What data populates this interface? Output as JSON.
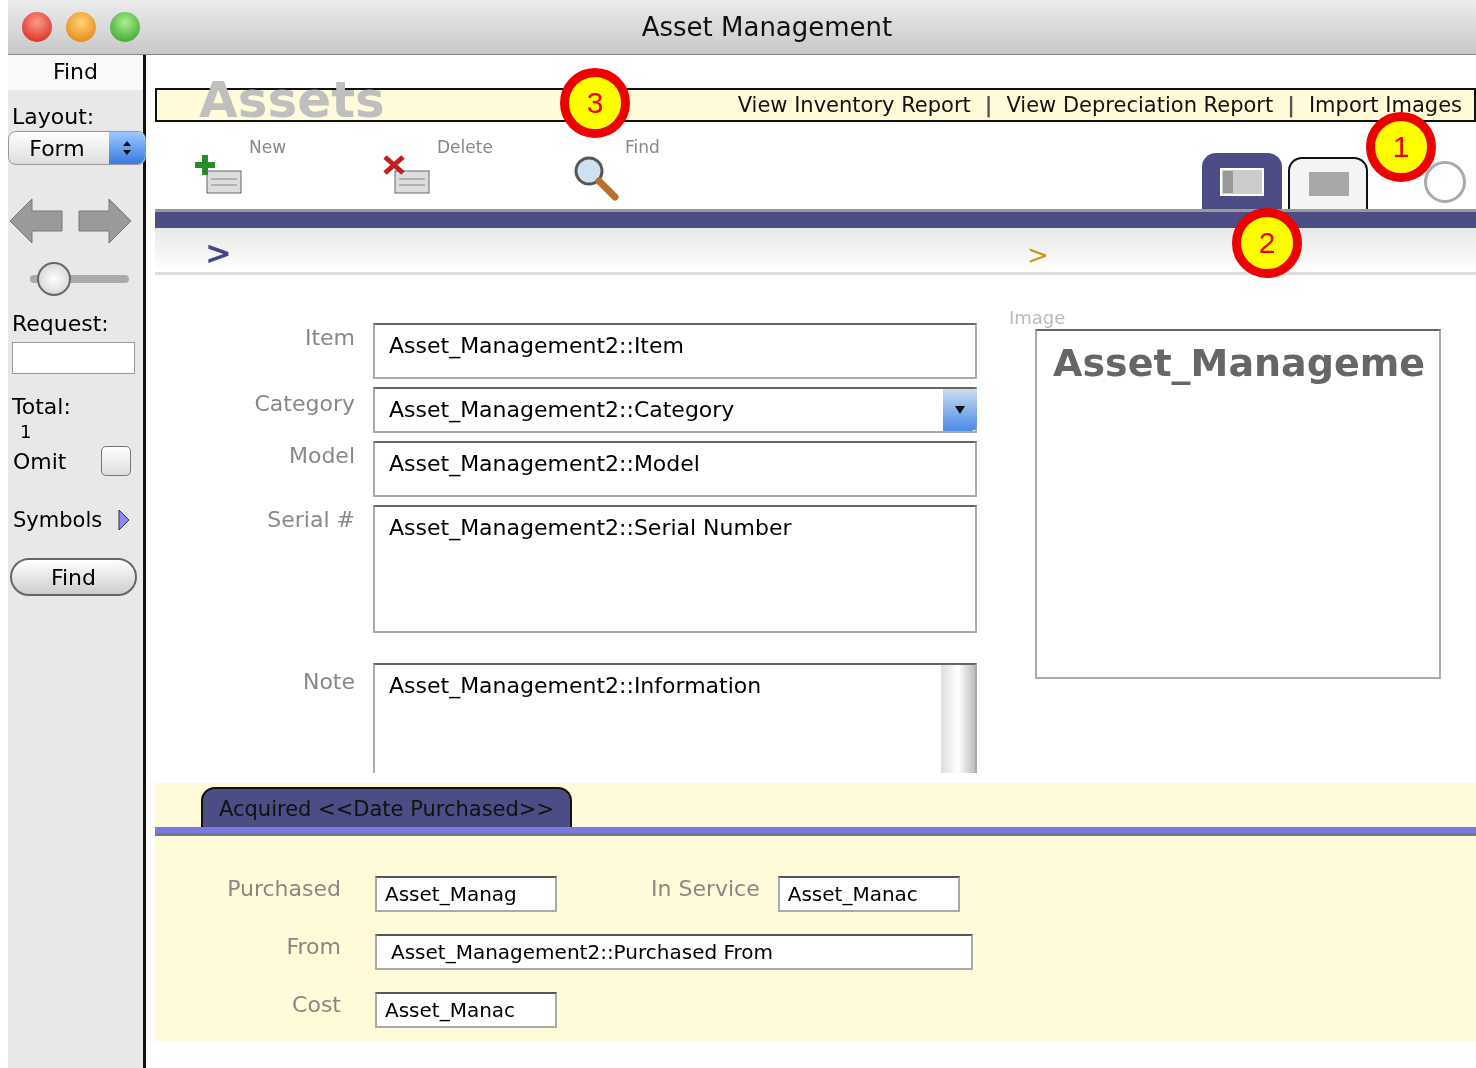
{
  "window": {
    "title": "Asset Management"
  },
  "sidebar": {
    "mode_title": "Find",
    "layout_label": "Layout:",
    "layout_value": "Form",
    "slider": {
      "level": 0.1
    },
    "request_label": "Request:",
    "total_label": "Total:",
    "total_value": "1",
    "omit": {
      "label": "Omit",
      "checked": false
    },
    "symbols_label": "Symbols",
    "find_button": "Find"
  },
  "header": {
    "title": "Assets",
    "links": [
      {
        "label": "View Inventory Report"
      },
      {
        "label": "View Depreciation Report"
      },
      {
        "label": "Import Images"
      }
    ],
    "separators": [
      "|",
      "|"
    ]
  },
  "toolbar": [
    {
      "kind": "new",
      "label": "New"
    },
    {
      "kind": "delete",
      "label": "Delete"
    },
    {
      "kind": "find",
      "label": "Find"
    }
  ],
  "view_tabs": [
    {
      "kind": "form",
      "selected": true
    },
    {
      "kind": "table",
      "selected": false
    }
  ],
  "breadcrumbs": [
    {
      "text": ">",
      "color": "#45458a"
    },
    {
      "text": ">",
      "color": "#c89a10"
    }
  ],
  "form": {
    "fields": [
      {
        "kind": "text",
        "label": "Item",
        "value": "Asset_Management2::Item"
      },
      {
        "kind": "dropdown",
        "label": "Category",
        "value": "Asset_Management2::Category"
      },
      {
        "kind": "text",
        "label": "Model",
        "value": "Asset_Management2::Model"
      },
      {
        "kind": "area",
        "label": "Serial #",
        "value": "Asset_Management2::Serial Number"
      },
      {
        "kind": "scroll",
        "label": "Note",
        "value": "Asset_Management2::Information"
      }
    ],
    "image": {
      "label": "Image",
      "value": "Asset_Manageme"
    }
  },
  "acquired": {
    "tab": "Acquired <<Date Purchased>>",
    "rows": [
      [
        {
          "label": "Purchased",
          "value": "Asset_Manag",
          "kind": "short"
        },
        {
          "label": "In Service",
          "value": "Asset_Manac",
          "kind": "short"
        }
      ],
      [
        {
          "label": "From",
          "value": "Asset_Management2::Purchased From",
          "kind": "long"
        }
      ],
      [
        {
          "label": "Cost",
          "value": "Asset_Manac",
          "kind": "short"
        }
      ]
    ]
  },
  "callouts": [
    {
      "number": "1"
    },
    {
      "number": "2"
    },
    {
      "number": "3"
    }
  ]
}
